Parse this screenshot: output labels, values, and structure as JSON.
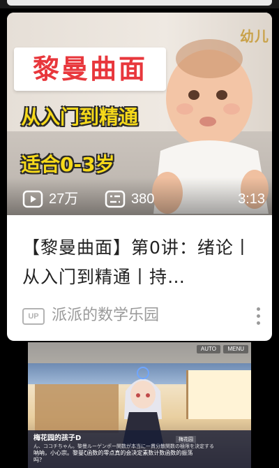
{
  "card": {
    "thumbnail": {
      "corner_text": "幼儿",
      "headline": "黎曼曲面",
      "subtitle_1": "从入门到精通",
      "subtitle_2": "适合0-3岁",
      "views": "27万",
      "danmaku": "380",
      "duration": "3:13"
    },
    "title": "【黎曼曲面】第0讲：绪论丨从入门到精通丨持…",
    "up_badge": "UP",
    "up_name": "派派的数学乐园"
  },
  "game": {
    "auto_label": "AUTO",
    "menu_label": "MENU",
    "speaker": "梅花园的孩子D",
    "speaker_tag": "梅花园",
    "line_jp": "ん、ココチちゃん。黎曼ルーゲンポー関数が本当に一貫分散関数の極限を決定する",
    "line_cn": "呐呐，小心宗。黎曼ζ函数的零点真的会决定素数计数函数的振荡吗？"
  },
  "colors": {
    "headline_red": "#e8373c",
    "subtitle_yellow": "#f6d91a",
    "muted_gray": "#9a9a9a"
  }
}
